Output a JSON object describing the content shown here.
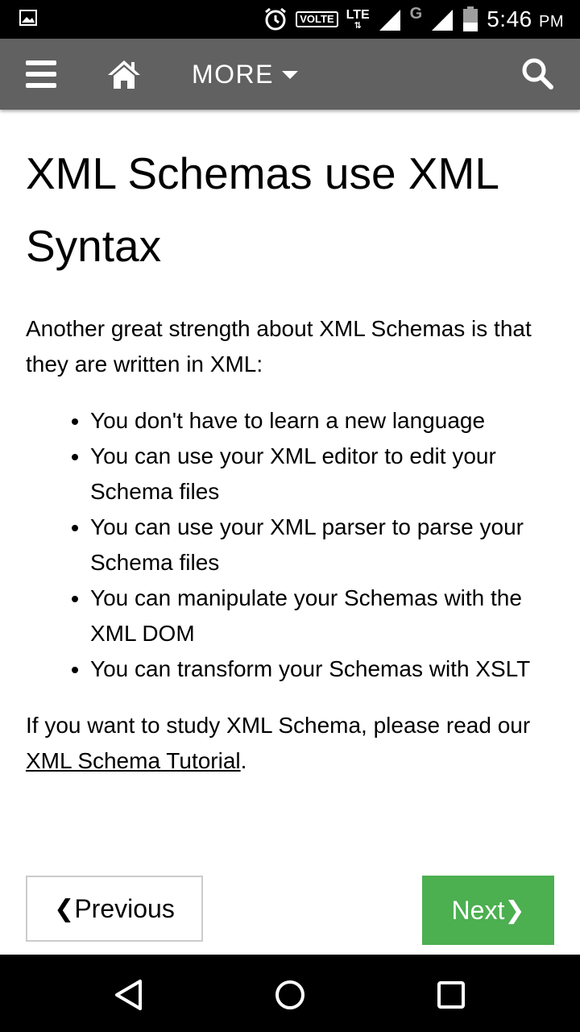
{
  "status_bar": {
    "volte_label": "VOLTE",
    "lte_label": "LTE",
    "lte_arrows": "⇅",
    "g_label": "G",
    "time": "5:46",
    "ampm": "PM",
    "icons": [
      "gallery-icon",
      "alarm-icon",
      "signal-icon",
      "battery-icon"
    ]
  },
  "nav": {
    "more_label": "MORE",
    "icons": [
      "menu-icon",
      "home-icon",
      "caret-down-icon",
      "search-icon"
    ]
  },
  "article": {
    "title": "XML Schemas use XML Syntax",
    "intro": "Another great strength about XML Schemas is that they are written in XML:",
    "bullets": [
      "You don't have to learn a new language",
      "You can use your XML editor to edit your Schema files",
      "You can use your XML parser to parse your Schema files",
      "You can manipulate your Schemas with the XML DOM",
      "You can transform your Schemas with XSLT"
    ],
    "outro_prefix": "If you want to study XML Schema, please read our",
    "outro_link": "XML Schema Tutorial",
    "outro_suffix": "."
  },
  "pager": {
    "prev_chevron": "❮",
    "prev_label": "Previous",
    "next_label": "Next",
    "next_chevron": "❯",
    "next_color": "#4caf50"
  },
  "system_nav": {
    "icons": [
      "back-icon",
      "home-circle-icon",
      "recents-icon"
    ]
  }
}
